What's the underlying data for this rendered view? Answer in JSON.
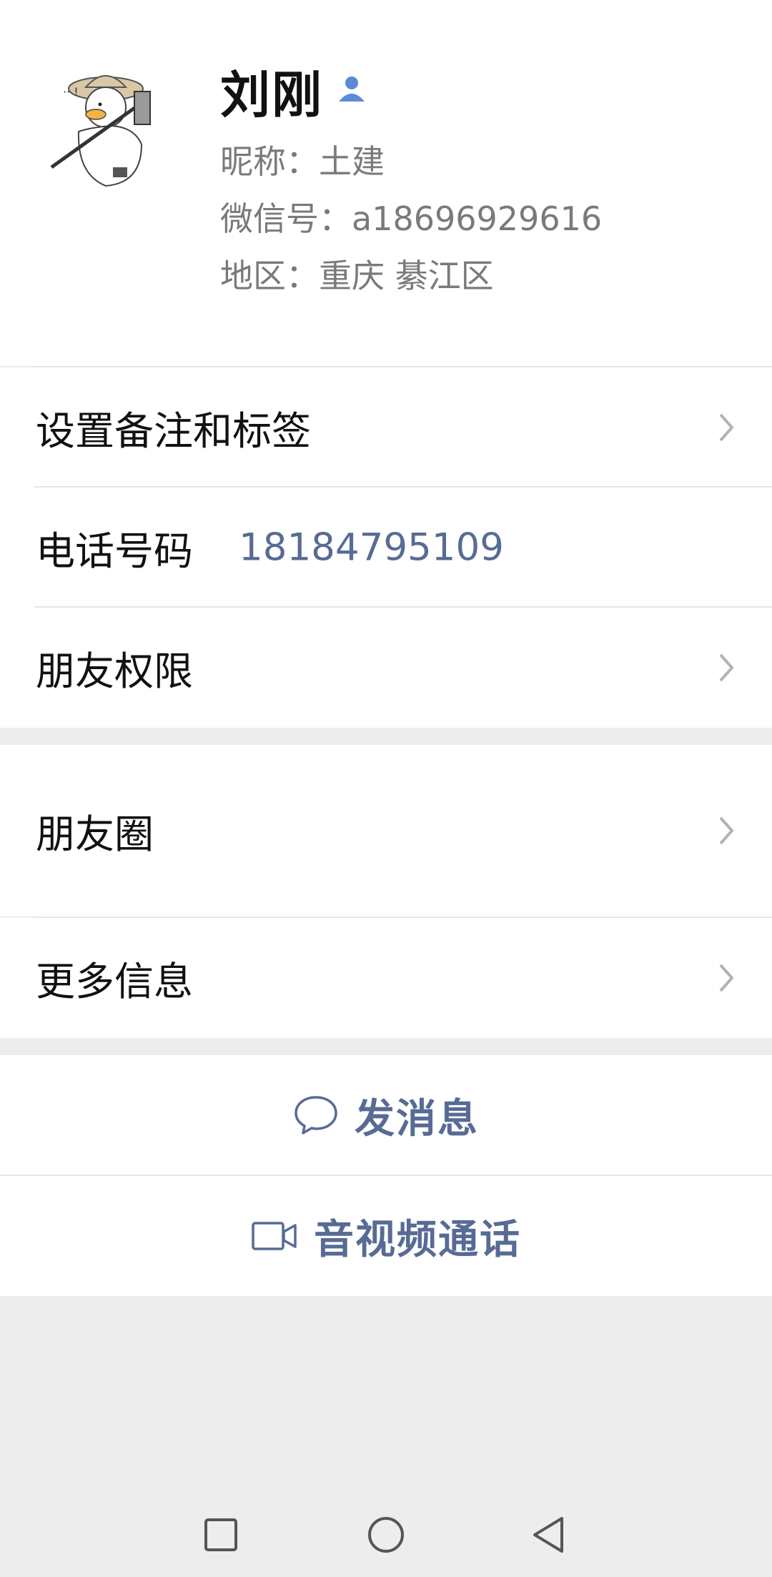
{
  "contact": {
    "name": "刘刚",
    "nickname": "昵称：土建",
    "wechat_id": "微信号：a18696929616",
    "region": "地区：重庆  綦江区"
  },
  "rows": {
    "remark": {
      "label": "设置备注和标签"
    },
    "phone": {
      "label": "电话号码",
      "value": "18184795109"
    },
    "permissions": {
      "label": "朋友权限"
    },
    "moments": {
      "label": "朋友圈"
    },
    "more_info": {
      "label": "更多信息"
    }
  },
  "actions": {
    "send_message": "发消息",
    "av_call": "音视频通话"
  },
  "icons": {
    "badge": "person-badge-icon",
    "chevron": "chevron-right-icon",
    "message": "chat-bubble-icon",
    "video": "video-camera-icon",
    "nav_recent": "square-icon",
    "nav_home": "circle-icon",
    "nav_back": "triangle-back-icon"
  },
  "colors": {
    "link": "#576b95",
    "background": "#ededed",
    "secondary_text": "#7a7a7a"
  }
}
